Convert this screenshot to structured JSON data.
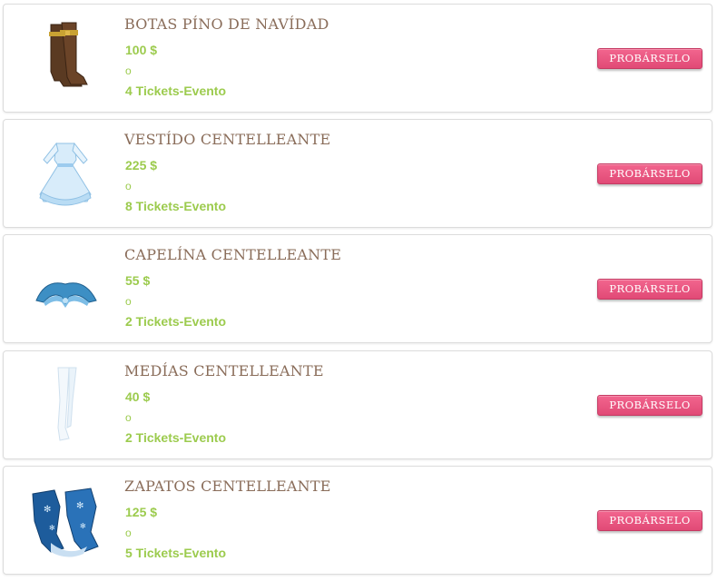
{
  "items": [
    {
      "name": "BOTAS PÍNO DE NAVÍDAD",
      "price": "100 $",
      "or": "o",
      "tickets": "4 Tickets-Evento",
      "button": "PROBÁRSELO",
      "icon": "boots-icon"
    },
    {
      "name": "VESTÍDO CENTELLEANTE",
      "price": "225 $",
      "or": "o",
      "tickets": "8 Tickets-Evento",
      "button": "PROBÁRSELO",
      "icon": "dress-icon"
    },
    {
      "name": "CAPELÍNA CENTELLEANTE",
      "price": "55 $",
      "or": "o",
      "tickets": "2 Tickets-Evento",
      "button": "PROBÁRSELO",
      "icon": "capelet-icon"
    },
    {
      "name": "MEDÍAS CENTELLEANTE",
      "price": "40 $",
      "or": "o",
      "tickets": "2 Tickets-Evento",
      "button": "PROBÁRSELO",
      "icon": "stockings-icon"
    },
    {
      "name": "ZAPATOS CENTELLEANTE",
      "price": "125 $",
      "or": "o",
      "tickets": "5 Tickets-Evento",
      "button": "PROBÁRSELO",
      "icon": "shoes-icon"
    }
  ],
  "colors": {
    "name_text": "#8a6d5a",
    "price_text": "#9ccb4e",
    "button_bg": "#e8547f",
    "card_border": "#dcdcdc"
  }
}
